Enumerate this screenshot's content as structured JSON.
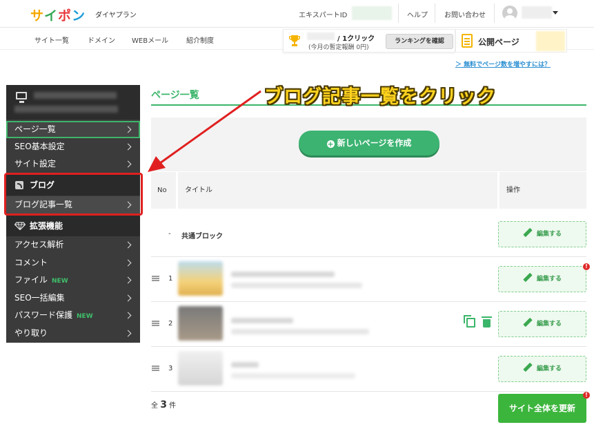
{
  "header": {
    "logo_parts": [
      "サ",
      "イ",
      "ポ",
      "ン"
    ],
    "plan": "ダイヤプラン",
    "expert_id_label": "エキスパートID",
    "help": "ヘルプ",
    "contact": "お問い合わせ"
  },
  "subnav": [
    "サイト一覧",
    "ドメイン",
    "WEBメール",
    "紹介制度"
  ],
  "ranking": {
    "rank": "/ 1クリック",
    "sub": "(今月の暫定報酬 0円)",
    "button": "ランキングを確認"
  },
  "public_page": "公開ページ",
  "free_link": "＞ 無料でページ数を増やすには？",
  "sidebar": {
    "top_items": [
      "ページ一覧",
      "SEO基本設定",
      "サイト設定"
    ],
    "blog_section": "ブログ",
    "blog_items": [
      "ブログ記事一覧"
    ],
    "ext_section": "拡張機能",
    "ext_items": [
      {
        "label": "アクセス解析",
        "new": ""
      },
      {
        "label": "コメント",
        "new": ""
      },
      {
        "label": "ファイル",
        "new": "NEW"
      },
      {
        "label": "SEO一括編集",
        "new": ""
      },
      {
        "label": "パスワード保護",
        "new": "NEW"
      },
      {
        "label": "やり取り",
        "new": ""
      }
    ]
  },
  "annotation": "ブログ記事一覧をクリック",
  "main": {
    "title": "ページ一覧",
    "new_button": "新しいページを作成",
    "columns": {
      "no": "No",
      "title": "タイトル",
      "action": "操作"
    },
    "common_row": {
      "no": "-",
      "title": "共通ブロック",
      "action": "編集する"
    },
    "rows": [
      {
        "no": "1",
        "action": "編集する"
      },
      {
        "no": "2",
        "action": "編集する"
      },
      {
        "no": "3",
        "action": "編集する"
      }
    ],
    "alert_mark": "!",
    "count_prefix": "全",
    "count_value": "3",
    "count_suffix": "件",
    "update_button": "サイト全体を更新"
  },
  "colors": {
    "accent": "#3bb56a",
    "annotation": "#ffd21e",
    "highlight": "#e02020",
    "sidebar_bg": "#3b3b3b"
  }
}
